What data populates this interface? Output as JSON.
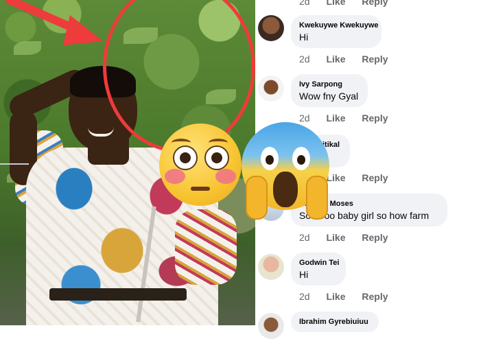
{
  "comments": [
    {
      "author": "",
      "text": "",
      "time": "2d",
      "like": "Like",
      "reply": "Reply"
    },
    {
      "author": "Kwekuywe Kwekuywe",
      "text": "Hi",
      "time": "2d",
      "like": "Like",
      "reply": "Reply"
    },
    {
      "author": "Ivy Sarpong",
      "text": "Wow fny Gyal",
      "time": "2d",
      "like": "Like",
      "reply": "Reply"
    },
    {
      "author": "itikal",
      "text": "",
      "time": "2d",
      "like": "Like",
      "reply": "Reply"
    },
    {
      "author": "Barjong Moses",
      "text": "So oooo baby girl  so how farm",
      "time": "2d",
      "like": "Like",
      "reply": "Reply"
    },
    {
      "author": "Godwin Tei",
      "text": "Hi",
      "time": "2d",
      "like": "Like",
      "reply": "Reply"
    },
    {
      "author": "Ibrahim Gyrebiuiuu",
      "text": "",
      "time": "",
      "like": "",
      "reply": ""
    }
  ],
  "colors": {
    "annotation_red": "#ee3b3b",
    "bubble_bg": "#f0f2f5",
    "meta_text": "#65676b"
  },
  "icons": [
    "red-arrow-icon",
    "flushed-face-emoji",
    "screaming-face-emoji"
  ]
}
